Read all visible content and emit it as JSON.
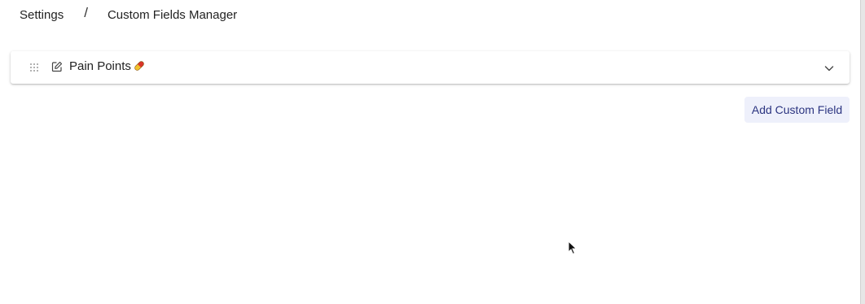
{
  "breadcrumb": {
    "root": "Settings",
    "separator": "/",
    "current": "Custom Fields Manager"
  },
  "custom_fields": [
    {
      "label": "Pain Points",
      "emoji_icon": "pill-icon",
      "icons": [
        "drag-handle-icon",
        "edit-icon",
        "chevron-down-icon"
      ],
      "expanded": false
    }
  ],
  "actions": {
    "add_label": "Add Custom Field"
  },
  "colors": {
    "add_button_bg": "#eef0fb",
    "add_button_text": "#2b3480",
    "pill_red": "#d9342b",
    "pill_yellow": "#f2c12e"
  }
}
